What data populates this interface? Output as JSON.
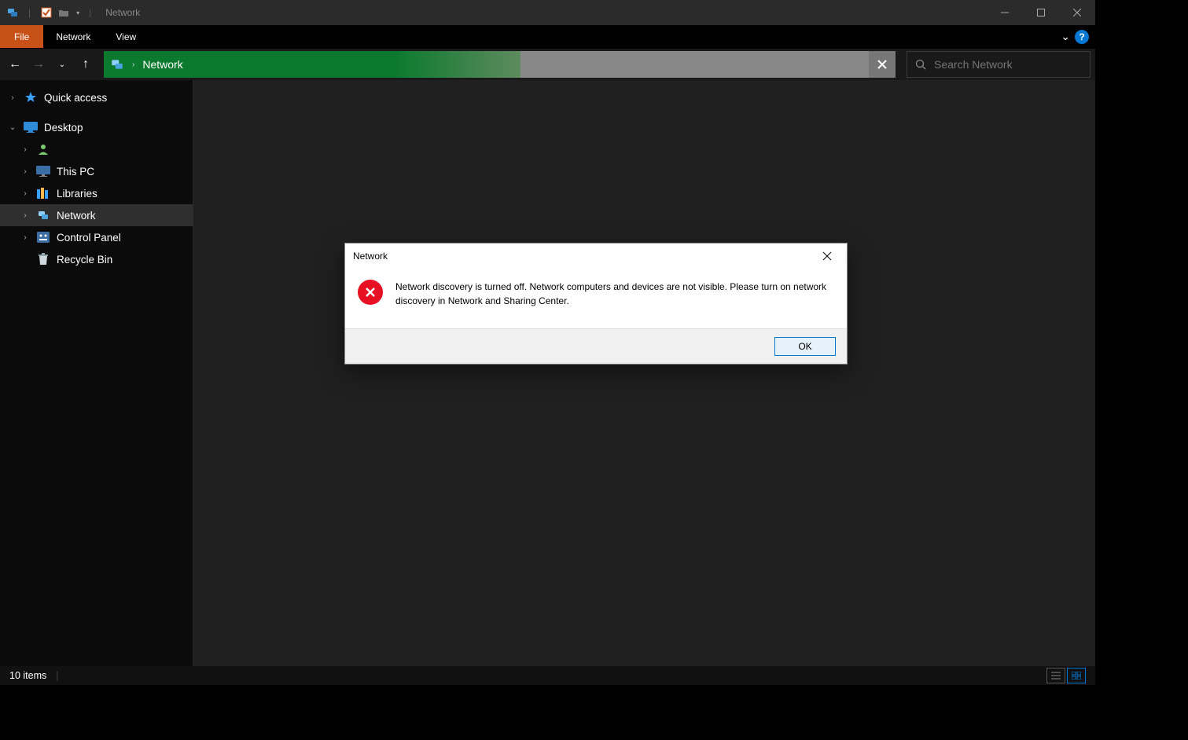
{
  "titlebar": {
    "title": "Network"
  },
  "ribbon": {
    "file": "File",
    "tabs": [
      "Network",
      "View"
    ]
  },
  "nav": {
    "address_text": "Network",
    "search_placeholder": "Search Network"
  },
  "sidebar": {
    "quick_access": "Quick access",
    "desktop": "Desktop",
    "items": [
      {
        "label": "This PC"
      },
      {
        "label": "Libraries"
      },
      {
        "label": "Network",
        "selected": true
      },
      {
        "label": "Control Panel"
      },
      {
        "label": "Recycle Bin"
      }
    ],
    "user_placeholder": ""
  },
  "statusbar": {
    "items_text": "10 items"
  },
  "dialog": {
    "title": "Network",
    "message": "Network discovery is turned off. Network computers and devices are not visible. Please turn on network discovery in Network and Sharing Center.",
    "ok": "OK"
  }
}
